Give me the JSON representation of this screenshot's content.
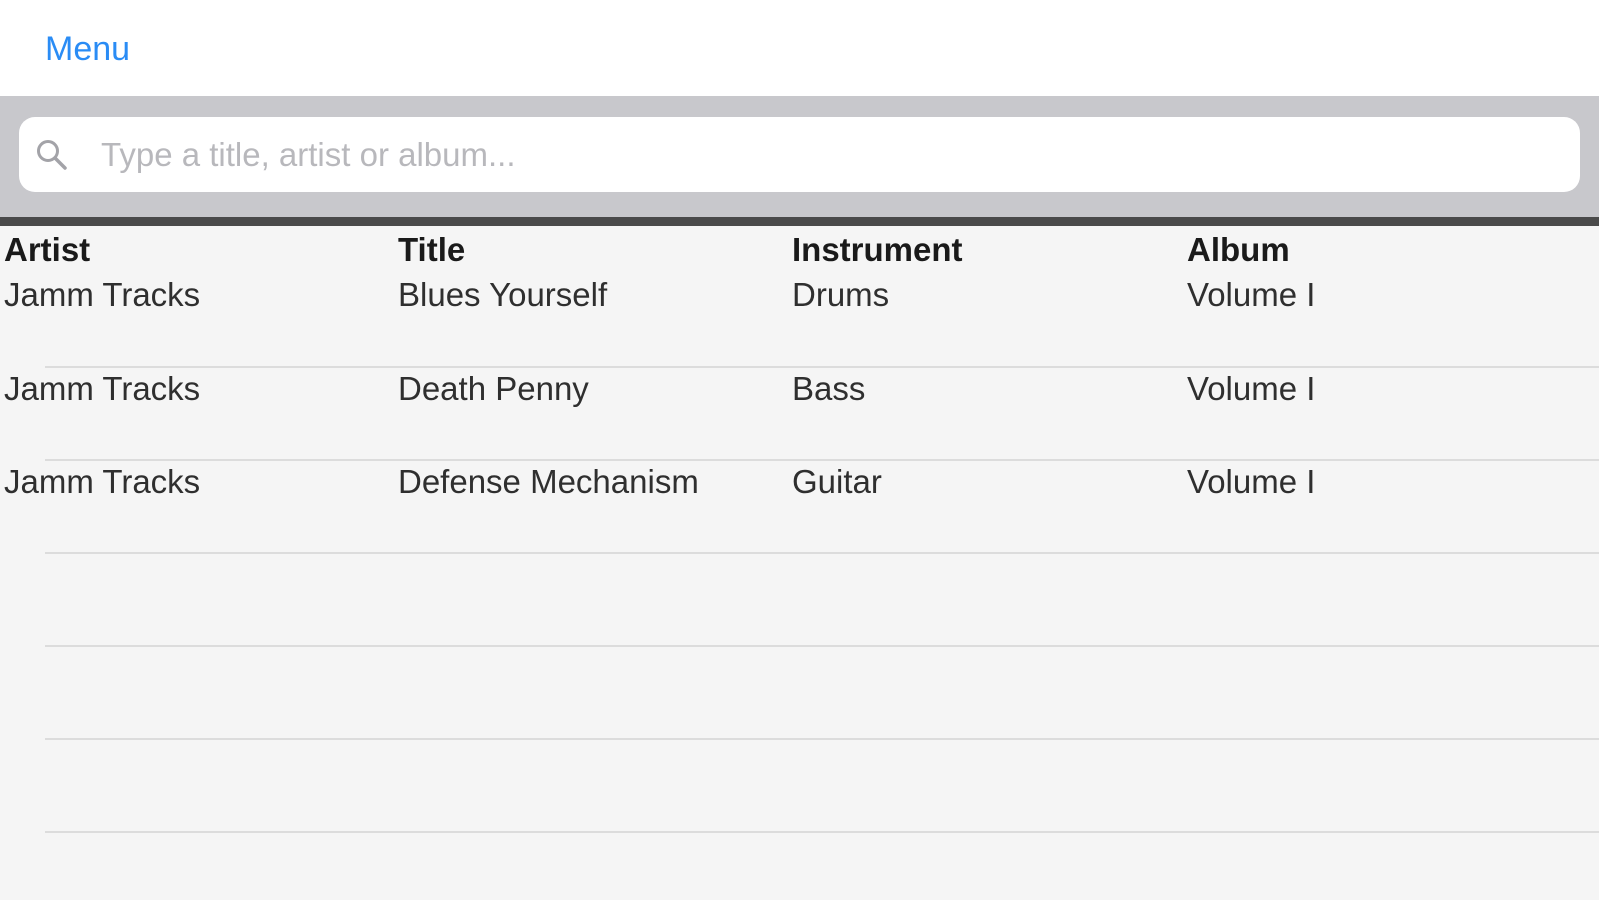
{
  "nav": {
    "menu_label": "Menu"
  },
  "search": {
    "placeholder": "Type a title, artist or album...",
    "value": ""
  },
  "table": {
    "columns": [
      "Artist",
      "Title",
      "Instrument",
      "Album"
    ],
    "rows": [
      [
        "Jamm Tracks",
        "Blues Yourself",
        "Drums",
        "Volume I"
      ],
      [
        "Jamm Tracks",
        "Death Penny",
        "Bass",
        "Volume I"
      ],
      [
        "Jamm Tracks",
        "Defense Mechanism",
        "Guitar",
        "Volume I"
      ]
    ]
  },
  "colors": {
    "accent": "#2a8cf5",
    "search_bar_bg": "#c8c8cc",
    "divider": "#4a4a4a",
    "list_bg": "#f5f5f5"
  }
}
